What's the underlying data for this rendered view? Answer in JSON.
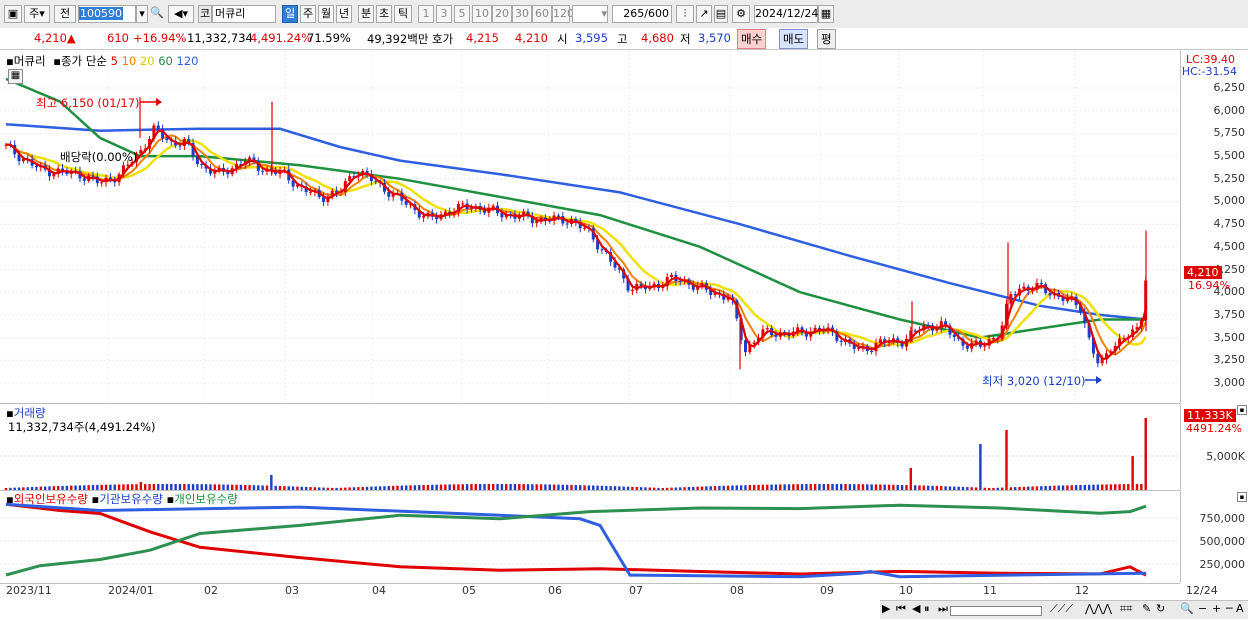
{
  "toolbar": {
    "market_btn": "주",
    "prev_btn": "전",
    "code": "100590",
    "type_btn": "코",
    "name": "머큐리",
    "periods": [
      "일",
      "주",
      "월",
      "년",
      "분",
      "초",
      "틱"
    ],
    "intervals": [
      "1",
      "3",
      "5",
      "10",
      "20",
      "30",
      "60",
      "120"
    ],
    "count": "265",
    "count_total": "/600",
    "date": "2024/12/24"
  },
  "quote": {
    "price": "4,210▲",
    "change": "610",
    "change_pct": "+16.94%",
    "volume": "11,332,734",
    "vol_pct": "4,491.24%",
    "turnover": "71.59%",
    "amount": "49,392백만",
    "ask_label": "호가",
    "ask_val": "4,215",
    "bid_val": "4,210",
    "open_label": "시",
    "open": "3,595",
    "high_label": "고",
    "high": "4,680",
    "low_label": "저",
    "low": "3,570",
    "buy_btn": "매수",
    "sell_btn": "매도",
    "avg_btn": "평"
  },
  "price_pane": {
    "legend_name": "머큐리",
    "legend_ma": "종가 단순",
    "ma_periods": [
      "5",
      "10",
      "20",
      "60",
      "120"
    ],
    "lc": "LC:39.40",
    "hc": "HC:-31.54",
    "ticks": [
      "6,250",
      "6,000",
      "5,750",
      "5,500",
      "5,250",
      "5,000",
      "4,750",
      "4,500",
      "4,250",
      "4,000",
      "3,750",
      "3,500",
      "3,250",
      "3,000"
    ],
    "current": "4,210",
    "current_pct": "16.94%",
    "high_label": "최고 6,150 (01/17)",
    "low_label": "최저 3,020 (12/10)",
    "dividend_label": "배당락(0.00%)"
  },
  "volume_pane": {
    "title": "거래량",
    "summary": "11,332,734주(4,491.24%)",
    "current": "11,333K",
    "current_pct": "4491.24%",
    "tick": "5,000K"
  },
  "holdings_pane": {
    "legends": [
      "외국인보유수량",
      "기관보유수량",
      "개인보유수량"
    ],
    "ticks": [
      "750,000",
      "500,000",
      "250,000"
    ]
  },
  "x_axis": [
    "2023/11",
    "2024/01",
    "02",
    "03",
    "04",
    "05",
    "06",
    "07",
    "08",
    "09",
    "10",
    "11",
    "12"
  ],
  "x_axis_right": "12/24",
  "colors": {
    "up": "#e00000",
    "down": "#1a3ec8",
    "ma5": "#e00000",
    "ma10": "#f08000",
    "ma20": "#f0e000",
    "ma60": "#1e9040",
    "ma120": "#2f5fe0",
    "selected": "#2f7fd8"
  }
}
